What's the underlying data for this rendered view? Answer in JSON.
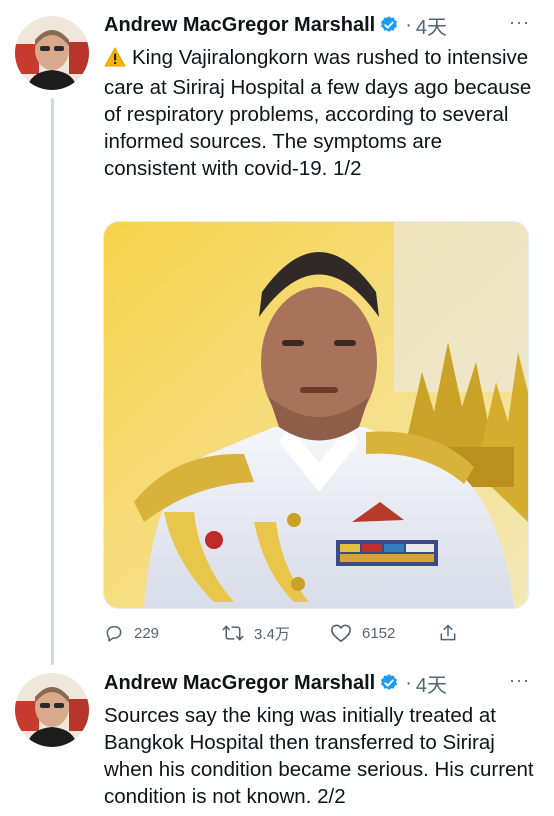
{
  "tweets": [
    {
      "author": "Andrew MacGregor Marshall",
      "separator": "·",
      "time": "4天",
      "more": "···",
      "text": "King Vajiralongkorn was rushed to intensive care at Siriraj Hospital a few days ago because of respiratory problems, according to several informed sources. The symptoms are consistent with covid-19. 1/2",
      "actions": {
        "replies": "229",
        "retweets": "3.4万",
        "likes": "6152"
      }
    },
    {
      "author": "Andrew MacGregor Marshall",
      "separator": "·",
      "time": "4天",
      "more": "···",
      "text": "Sources say the king was initially treated at Bangkok Hospital then transferred to Siriraj when his condition became serious. His current condition is not known. 2/2"
    }
  ],
  "colors": {
    "verified": "#1d9bf0",
    "muted": "#536471",
    "text": "#0f1419"
  },
  "icons": [
    "verified-icon",
    "warning-icon",
    "reply-icon",
    "retweet-icon",
    "like-icon",
    "share-icon",
    "more-icon"
  ]
}
